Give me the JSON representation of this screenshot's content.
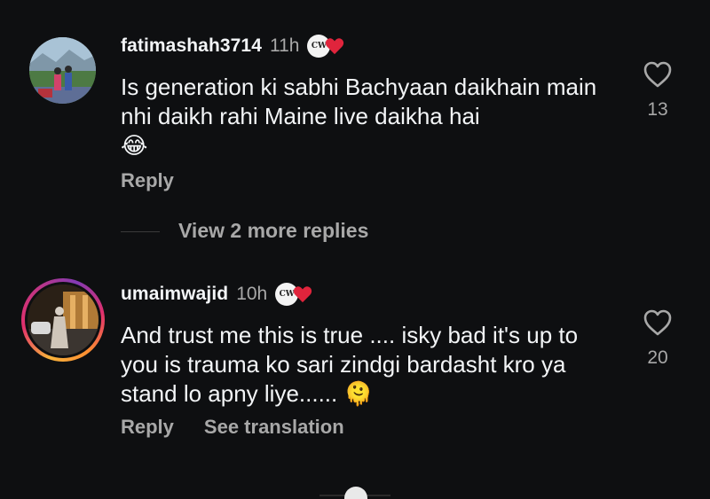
{
  "comments": [
    {
      "username": "fatimashah3714",
      "time": "11h",
      "badge_text": "CW",
      "text": "Is generation ki sabhi Bachyaan daikhain main nhi daikh rahi Maine live daikha hai",
      "emoji": "😂",
      "likes": "13",
      "reply_label": "Reply"
    },
    {
      "username": "umaimwajid",
      "time": "10h",
      "badge_text": "CW",
      "text": "And trust me this is true .... isky bad it's up to you is trauma ko sari zindgi bardasht kro ya stand lo apny liye......",
      "emoji": "🫠",
      "likes": "20",
      "reply_label": "Reply",
      "translation_label": "See translation"
    }
  ],
  "view_more_label": "View 2 more replies",
  "colors": {
    "background": "#0e0f11",
    "primary_text": "#f3f5f7",
    "secondary_text": "#a8a8a8",
    "badge_heart": "#e0243c"
  },
  "icons": {
    "like": "heart-outline-icon",
    "badge": "heart-badge-icon"
  }
}
